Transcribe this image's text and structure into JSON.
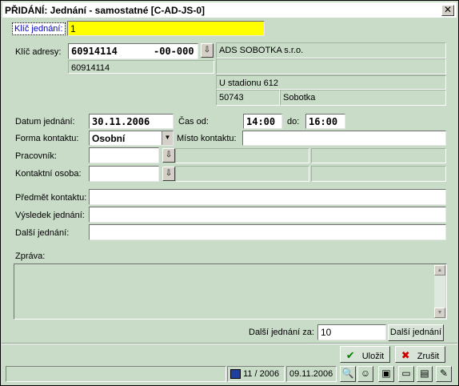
{
  "window": {
    "title": "PŘIDÁNÍ: Jednání - samostatné [C-AD-JS-0]",
    "close": "✕"
  },
  "klic_jednani": {
    "label": "Klíč jednání:",
    "value": "1"
  },
  "adresa": {
    "label": "Klíč adresy:",
    "klic": "60914114",
    "suffix": "-00-000",
    "klic_below": "60914114",
    "firma": "ADS SOBOTKA  s.r.o.",
    "line2": "",
    "line3": "",
    "ulice": "U stadionu 612",
    "psc": "50743",
    "mesto": "Sobotka"
  },
  "datum": {
    "label": "Datum jednání:",
    "value": "30.11.2006"
  },
  "cas_od": {
    "label": "Čas od:",
    "value": "14:00"
  },
  "cas_do": {
    "label": "do:",
    "value": "16:00"
  },
  "forma": {
    "label": "Forma kontaktu:",
    "value": "Osobní"
  },
  "misto": {
    "label": "Místo kontaktu:",
    "value": ""
  },
  "pracovnik": {
    "label": "Pracovník:",
    "value": ""
  },
  "kontaktni_osoba": {
    "label": "Kontaktní osoba:",
    "value": ""
  },
  "predmet": {
    "label": "Předmět kontaktu:",
    "value": ""
  },
  "vysledek": {
    "label": "Výsledek jednání:",
    "value": ""
  },
  "dalsi": {
    "label": "Další jednání:",
    "value": ""
  },
  "zprava": {
    "label": "Zpráva:",
    "value": ""
  },
  "dalsi_za": {
    "label": "Další jednání za:",
    "value": "10",
    "button": "Další jednání"
  },
  "actions": {
    "ulozit": "Uložit",
    "zrusit": "Zrušit"
  },
  "statusbar": {
    "period": "11 / 2006",
    "date": "09.11.2006"
  },
  "colors": {
    "title_bg": "#ffffff",
    "window_bg": "#c8dcc8",
    "focus_yellow": "#ffff00"
  }
}
